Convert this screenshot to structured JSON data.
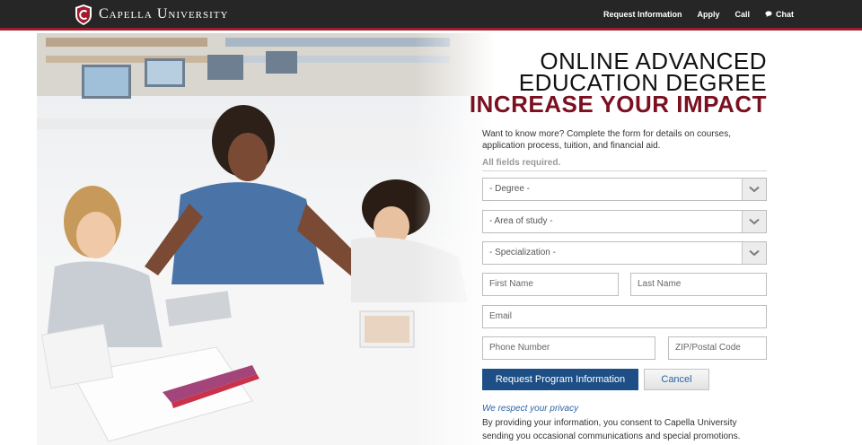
{
  "header": {
    "logo_text": "Capella University",
    "nav": {
      "request_info": "Request Information",
      "apply": "Apply",
      "call": "Call",
      "chat": "Chat"
    }
  },
  "hero": {
    "image_description": ""
  },
  "form": {
    "headline_line1": "ONLINE ADVANCED",
    "headline_line2": "EDUCATION DEGREE",
    "headline_line3": "INCREASE YOUR IMPACT",
    "intro": "Want to know more? Complete the form for details on courses, application process, tuition, and financial aid.",
    "required_note": "All fields required.",
    "degree_placeholder": "- Degree -",
    "area_placeholder": "- Area of study -",
    "specialization_placeholder": "- Specialization -",
    "first_name_placeholder": "First Name",
    "last_name_placeholder": "Last Name",
    "email_placeholder": "Email",
    "phone_placeholder": "Phone Number",
    "zip_placeholder": "ZIP/Postal Code",
    "submit_label": "Request Program Information",
    "cancel_label": "Cancel",
    "privacy_link": "We respect your privacy",
    "consent_text": "By providing your information, you consent to Capella University sending you occasional communications and special promotions."
  },
  "colors": {
    "topbar": "#262626",
    "accent_red": "#a01c2c",
    "headline_red": "#7a1020",
    "button_blue": "#1d4f86",
    "link_blue": "#2a64a8"
  }
}
